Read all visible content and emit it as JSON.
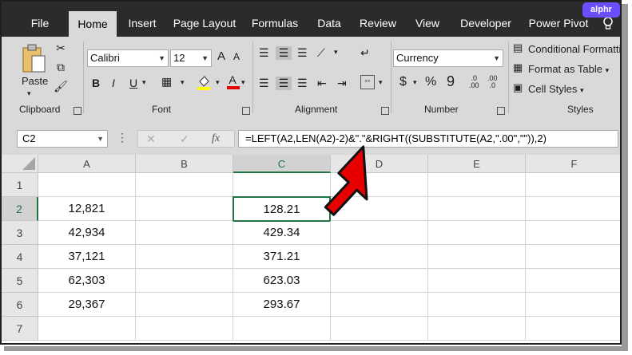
{
  "badge": "alphr",
  "tabs": [
    "File",
    "Home",
    "Insert",
    "Page Layout",
    "Formulas",
    "Data",
    "Review",
    "View",
    "Developer",
    "Power Pivot"
  ],
  "ribbon": {
    "clipboard": {
      "label": "Clipboard",
      "paste": "Paste"
    },
    "font": {
      "label": "Font",
      "name": "Calibri",
      "size": "12",
      "bold": "B",
      "italic": "I",
      "underline": "U",
      "grow": "A",
      "shrink": "A",
      "fontcolor": "A"
    },
    "alignment": {
      "label": "Alignment"
    },
    "number": {
      "label": "Number",
      "format": "Currency",
      "currency": "$",
      "percent": "%",
      "comma": "9"
    },
    "styles": {
      "label": "Styles",
      "conditional": "Conditional Formatti",
      "table": "Format as Table",
      "cell": "Cell Styles"
    }
  },
  "formula_bar": {
    "name_box": "C2",
    "formula": "=LEFT(A2,LEN(A2)-2)&\".\"&RIGHT((SUBSTITUTE(A2,\".00\",\"\")),2)",
    "fx": "fx"
  },
  "columns": [
    "A",
    "B",
    "C",
    "D",
    "E",
    "F"
  ],
  "rows": [
    {
      "num": "1",
      "A": "",
      "C": ""
    },
    {
      "num": "2",
      "A": "12,821",
      "C": "128.21"
    },
    {
      "num": "3",
      "A": "42,934",
      "C": "429.34"
    },
    {
      "num": "4",
      "A": "37,121",
      "C": "371.21"
    },
    {
      "num": "5",
      "A": "62,303",
      "C": "623.03"
    },
    {
      "num": "6",
      "A": "29,367",
      "C": "293.67"
    },
    {
      "num": "7",
      "A": "",
      "C": ""
    }
  ],
  "colors": {
    "accent": "#217346",
    "tabbar": "#2b2b2b",
    "ribbon": "#d9d9d9",
    "arrow": "#e60000"
  }
}
